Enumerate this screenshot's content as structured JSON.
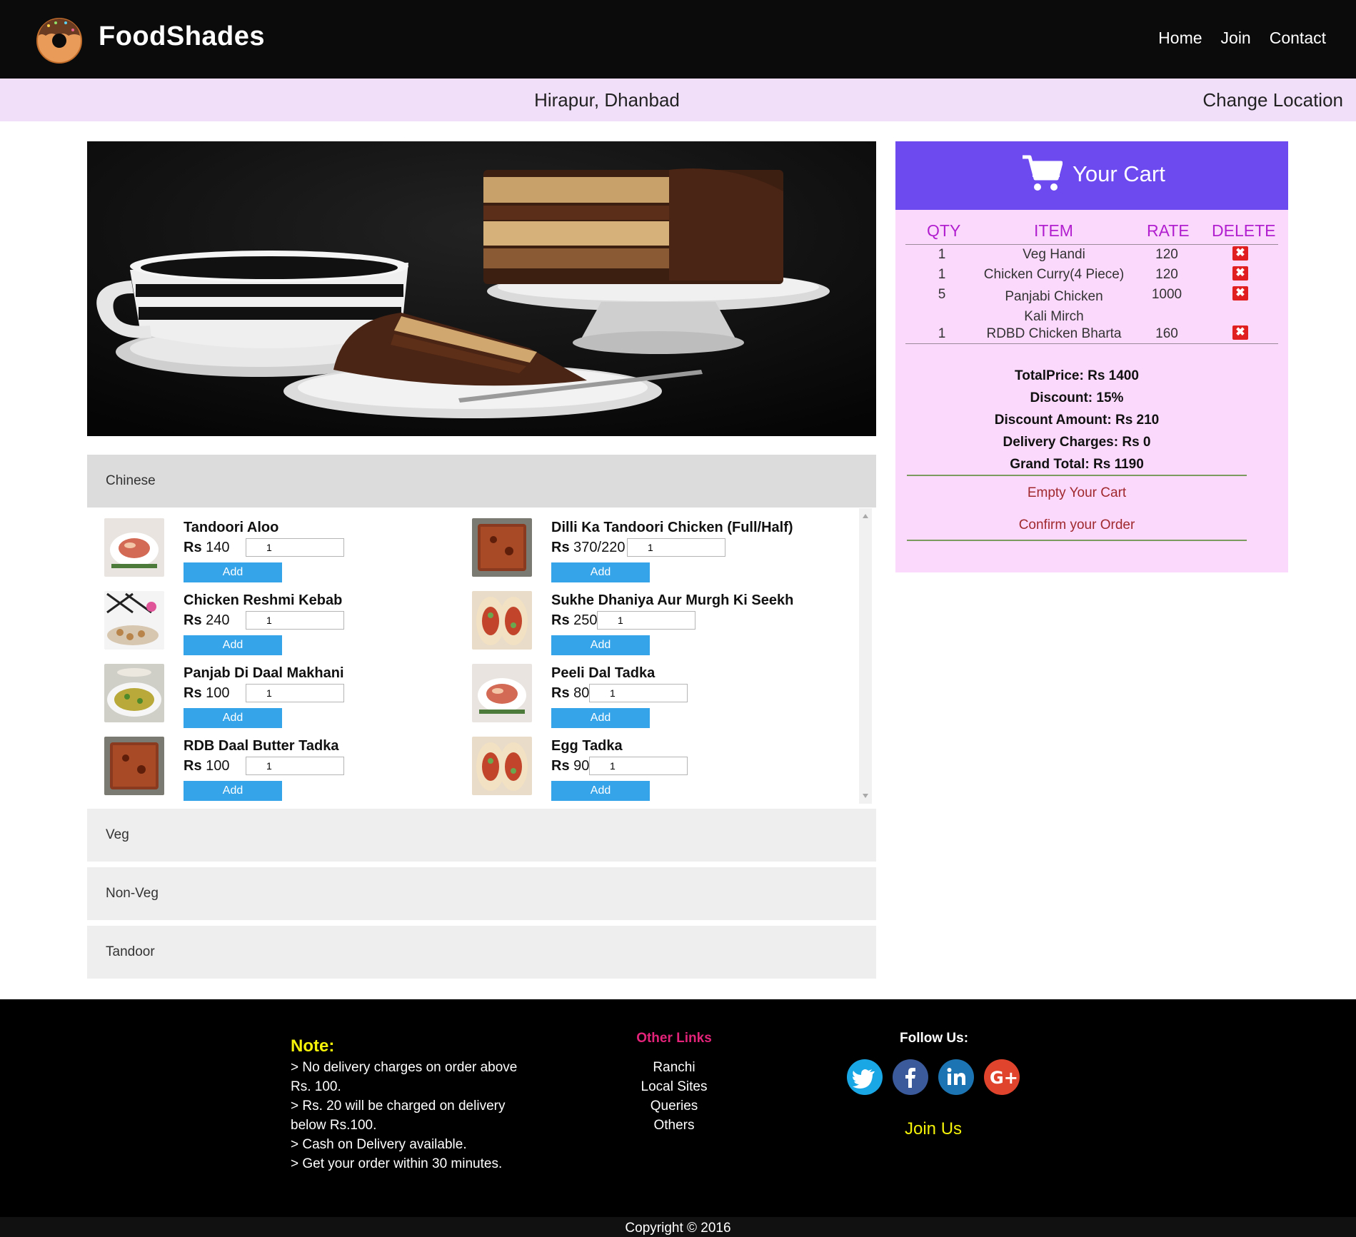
{
  "header": {
    "brand": "FoodShades",
    "nav": [
      "Home",
      "Join",
      "Contact"
    ]
  },
  "location": {
    "city": "Hirapur, Dhanbad",
    "change": "Change Location"
  },
  "categories": {
    "active": "Chinese",
    "others": [
      "Veg",
      "Non-Veg",
      "Tandoor"
    ]
  },
  "menu_items": [
    {
      "name": "Tandoori Aloo",
      "price": "140",
      "qty": "1",
      "add": "Add"
    },
    {
      "name": "Dilli Ka Tandoori Chicken (Full/Half)",
      "price": "370/220",
      "qty": "1",
      "add": "Add"
    },
    {
      "name": "Chicken Reshmi Kebab",
      "price": "240",
      "qty": "1",
      "add": "Add"
    },
    {
      "name": "Sukhe Dhaniya Aur Murgh Ki Seekh",
      "price": "250",
      "qty": "1",
      "add": "Add"
    },
    {
      "name": "Panjab Di Daal Makhani",
      "price": "100",
      "qty": "1",
      "add": "Add"
    },
    {
      "name": "Peeli Dal Tadka",
      "price": "80",
      "qty": "1",
      "add": "Add"
    },
    {
      "name": "RDB Daal Butter Tadka",
      "price": "100",
      "qty": "1",
      "add": "Add"
    },
    {
      "name": "Egg Tadka",
      "price": "90",
      "qty": "1",
      "add": "Add"
    }
  ],
  "price_prefix": "Rs",
  "cart": {
    "title": "Your Cart",
    "columns": [
      "QTY",
      "ITEM",
      "RATE",
      "DELETE"
    ],
    "rows": [
      {
        "qty": "1",
        "item": "Veg Handi",
        "rate": "120"
      },
      {
        "qty": "1",
        "item": "Chicken Curry(4 Piece)",
        "rate": "120"
      },
      {
        "qty": "5",
        "item": "Panjabi Chicken Kali Mirch",
        "rate": "1000"
      },
      {
        "qty": "1",
        "item": "RDBD Chicken Bharta",
        "rate": "160"
      }
    ],
    "delete_glyph": "✖",
    "summary": {
      "total": "TotalPrice: Rs 1400",
      "discount": "Discount: 15%",
      "discount_amount": "Discount Amount: Rs 210",
      "delivery": "Delivery Charges: Rs 0",
      "grand_total": "Grand Total: Rs 1190"
    },
    "empty": "Empty Your Cart",
    "confirm": "Confirm your Order"
  },
  "footer": {
    "note_title": "Note:",
    "notes": [
      "> No delivery charges on order above Rs. 100.",
      "> Rs. 20 will be charged on delivery below Rs.100.",
      "> Cash on Delivery available.",
      "> Get your order within 30 minutes."
    ],
    "links_title": "Other Links",
    "links": [
      "Ranchi",
      "Local Sites",
      "Queries",
      "Others"
    ],
    "follow_title": "Follow Us:",
    "join_us": "Join Us",
    "copyright": "Copyright © 2016"
  },
  "icons": {
    "social": [
      "twitter-icon",
      "facebook-icon",
      "linkedin-icon",
      "google-plus-icon"
    ]
  },
  "colors": {
    "cart_header": "#6d4af0",
    "cart_body": "#fbd9fc",
    "add_button": "#35a4e8",
    "note_title": "#f5f20a",
    "links_title": "#e3237a"
  }
}
